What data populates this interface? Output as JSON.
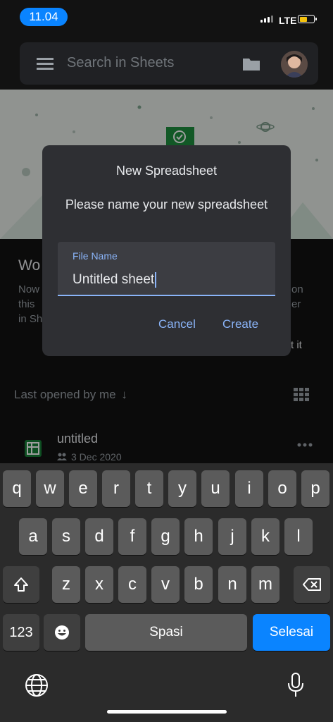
{
  "status_bar": {
    "time": "11.04",
    "network": "LTE",
    "battery_color": "#f4c20d"
  },
  "search": {
    "placeholder": "Search in Sheets"
  },
  "promo": {
    "title": "Wo",
    "text_left": "Now\nthis\nin Sh",
    "text_right": "on\ner",
    "action": "t it"
  },
  "list": {
    "sort_label": "Last opened by me",
    "files": [
      {
        "name": "untitled",
        "date": "3 Dec 2020"
      }
    ]
  },
  "dialog": {
    "title": "New Spreadsheet",
    "message": "Please name your new spreadsheet",
    "field_label": "File Name",
    "field_value": "Untitled sheet",
    "cancel": "Cancel",
    "create": "Create"
  },
  "keyboard": {
    "row1": [
      "q",
      "w",
      "e",
      "r",
      "t",
      "y",
      "u",
      "i",
      "o",
      "p"
    ],
    "row2": [
      "a",
      "s",
      "d",
      "f",
      "g",
      "h",
      "j",
      "k",
      "l"
    ],
    "row3": [
      "z",
      "x",
      "c",
      "v",
      "b",
      "n",
      "m"
    ],
    "numbers": "123",
    "space": "Spasi",
    "done": "Selesai"
  }
}
